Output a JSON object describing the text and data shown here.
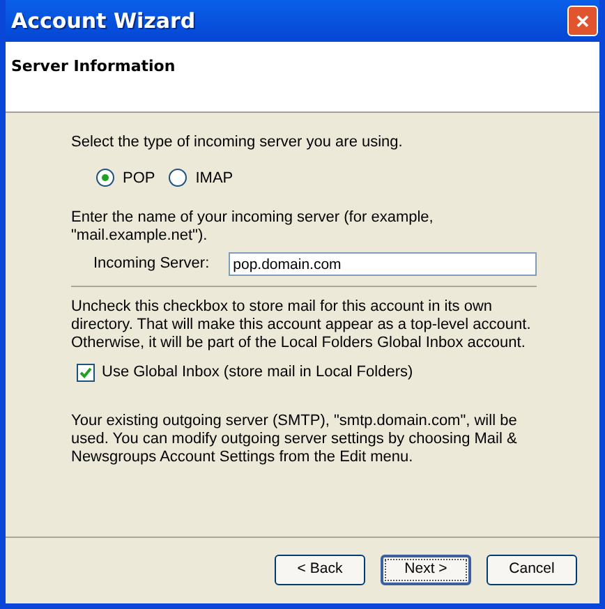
{
  "window": {
    "title": "Account Wizard",
    "close_label": "✕"
  },
  "header": {
    "title": "Server Information"
  },
  "server_type": {
    "prompt": "Select the type of incoming server you are using.",
    "options": [
      {
        "label": "POP",
        "selected": true
      },
      {
        "label": "IMAP",
        "selected": false
      }
    ]
  },
  "server_name": {
    "prompt": "Enter the name of your incoming server (for example, \"mail.example.net\").",
    "label": "Incoming Server:",
    "value": "pop.domain.com"
  },
  "global_inbox": {
    "description": "Uncheck this checkbox to store mail for this account in its own directory. That will make this account appear as a top-level account. Otherwise, it will be part of the Local Folders Global Inbox account.",
    "label": "Use Global Inbox (store mail in Local Folders)",
    "checked": true
  },
  "outgoing_note": "Your existing outgoing server (SMTP), \"smtp.domain.com\", will be used. You can modify outgoing server settings by choosing Mail & Newsgroups Account Settings from the Edit menu.",
  "buttons": [
    {
      "label": "< Back",
      "focused": false
    },
    {
      "label": "Next >",
      "focused": true
    },
    {
      "label": "Cancel",
      "focused": false
    }
  ]
}
